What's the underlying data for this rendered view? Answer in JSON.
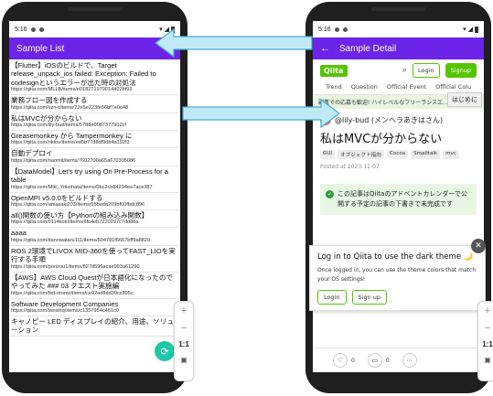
{
  "left_phone": {
    "status_time": "5:16",
    "appbar_title": "Sample List",
    "items": [
      {
        "title": "【Flutter】iOSのビルドで、Target release_unpack_ios failed: Exception: Failed to codesignというエラーが出た時の対処法",
        "url": "https://qiita.com/MLLB/items/e018271979014402bf93"
      },
      {
        "title": "業務フロー図を作成する",
        "url": "https://qiita.com/szn-t/items/22e5e223fe56bf7e0c48"
      },
      {
        "title": "私はMVCが分からない",
        "url": "https://qiita.com/lily-bud/items/5788e0087377b02cf"
      },
      {
        "title": "Greasemonkey から Tampermonkey に",
        "url": "https://qiita.com/riktov/items/ed5b77d8df9db4a192f3"
      },
      {
        "title": "自動デプロイ",
        "url": "https://qiita.com/naomit/items/7602700a65a670305086"
      },
      {
        "title": "【DataModel】Let's try using On Pre-Process for a table",
        "url": "https://qiita.com/Miki_Yokohata/items/0bc2cb84294ee7ace387"
      },
      {
        "title": "OpenMPI v5.0.0をビルドする",
        "url": "https://qiita.com/amasaki203/items/65beda209bf00fbdc896"
      },
      {
        "title": "all()関数の使い方【Pythonの組み込み関数】",
        "url": "https://qiita.com/0114kokI/items/6fc4eb7220297c7dd88a"
      },
      {
        "title": "aaaa",
        "url": "https://qiita.com/itanowataru111/items/504781f6667bff9a8820"
      },
      {
        "title": "ROS 2環境でLIVOX MID-360を使ってFAST_LIOを実行する手順",
        "url": "https://qiita.com/porizou1/items/827d596acae993a61290"
      },
      {
        "title": "【AWS】AWS Cloud Questが日本語化になったのでやってみた ### 03 クエスト実施編",
        "url": "https://qiita.com/fsd-otomo/items/ce92ed8dd39cc895c"
      },
      {
        "title": "Software Development Companies",
        "url": "https://qiita.com/tanishq/items/c1357954c461c0"
      },
      {
        "title": "キャノピー LED ディスプレイの紹介、用途、ソリューション",
        "url": ""
      }
    ],
    "fab_icon": "refresh-icon",
    "zoom_label": "1:1"
  },
  "right_phone": {
    "status_time": "5:16",
    "appbar_title": "Sample Detail",
    "qiita_logo": "Qiita",
    "login_label": "Login",
    "signup_label": "Signup",
    "tabs": [
      "Trend",
      "Question",
      "Official Event",
      "Official Colu"
    ],
    "hajimeni": "はじめに",
    "banner": "副業での応募も歓迎! ハイレベルなフリーランスエ...",
    "author": "@lily-bud (メンヘラあきはさん)",
    "title": "私はMVCが分からない",
    "tags": [
      "GUI",
      "オブジェクト指向",
      "Cocoa",
      "Smalltalk",
      "mvc"
    ],
    "posted": "Posted at 2023-11-07",
    "notice": "この記事はQiitaのアドベントカレンダーで公開する予定の記事の下書きで未完成です",
    "dark_title": "Log in to Qiita to use the dark theme 🌙",
    "dark_body": "Once logged in, you can use the theme colors that match your OS settings!",
    "dark_login": "Login",
    "dark_signup": "Sign up",
    "like_count": "0",
    "stock_count": "0",
    "zoom_label": "1:1"
  },
  "colors": {
    "appbar": "#6b24e8",
    "qiita_green": "#55c500",
    "arrow_fill": "#bfeaf5",
    "arrow_stroke": "#4aa9d6"
  }
}
